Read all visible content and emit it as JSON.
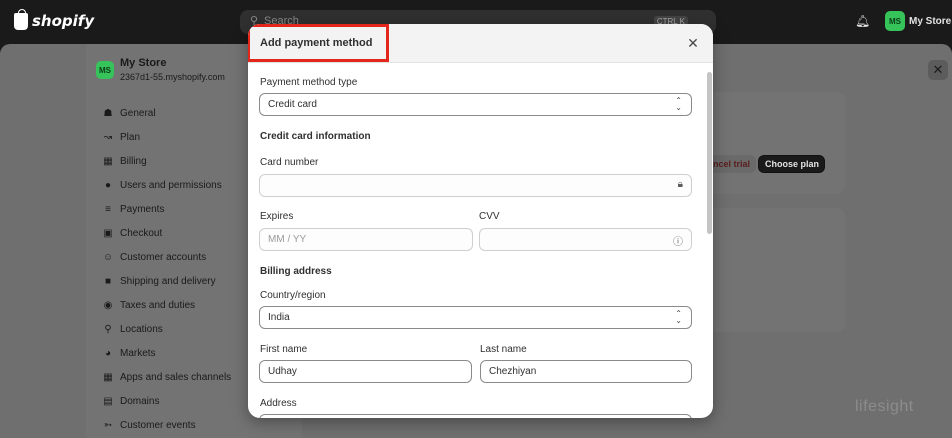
{
  "topbar": {
    "logo_text": "shopify",
    "search_placeholder": "Search",
    "search_shortcut": "CTRL K",
    "store_avatar": "MS",
    "store_name": "My Store"
  },
  "sidebar": {
    "store_avatar": "MS",
    "store_name": "My Store",
    "store_domain": "2367d1-55.myshopify.com",
    "items": [
      {
        "label": "General",
        "icon": "store-icon"
      },
      {
        "label": "Plan",
        "icon": "chart-icon"
      },
      {
        "label": "Billing",
        "icon": "billing-icon"
      },
      {
        "label": "Users and permissions",
        "icon": "users-icon"
      },
      {
        "label": "Payments",
        "icon": "payments-icon"
      },
      {
        "label": "Checkout",
        "icon": "cart-icon"
      },
      {
        "label": "Customer accounts",
        "icon": "person-icon"
      },
      {
        "label": "Shipping and delivery",
        "icon": "truck-icon"
      },
      {
        "label": "Taxes and duties",
        "icon": "tax-icon"
      },
      {
        "label": "Locations",
        "icon": "location-icon"
      },
      {
        "label": "Markets",
        "icon": "globe-icon"
      },
      {
        "label": "Apps and sales channels",
        "icon": "apps-icon"
      },
      {
        "label": "Domains",
        "icon": "domain-icon"
      },
      {
        "label": "Customer events",
        "icon": "cursor-icon"
      }
    ]
  },
  "background": {
    "cancel_trial_label": "ncel trial",
    "choose_plan_label": "Choose plan",
    "watermark": "lifesight"
  },
  "modal": {
    "title": "Add payment method",
    "payment_type_label": "Payment method type",
    "payment_type_value": "Credit card",
    "card_section": "Credit card information",
    "card_number_label": "Card number",
    "card_number_value": "",
    "expires_label": "Expires",
    "expires_placeholder": "MM / YY",
    "cvv_label": "CVV",
    "cvv_value": "",
    "billing_section": "Billing address",
    "country_label": "Country/region",
    "country_value": "India",
    "first_name_label": "First name",
    "first_name_value": "Udhay",
    "last_name_label": "Last name",
    "last_name_value": "Chezhiyan",
    "address_label": "Address"
  },
  "colors": {
    "highlight": "#e3261c",
    "brand_green": "#36c35a"
  }
}
